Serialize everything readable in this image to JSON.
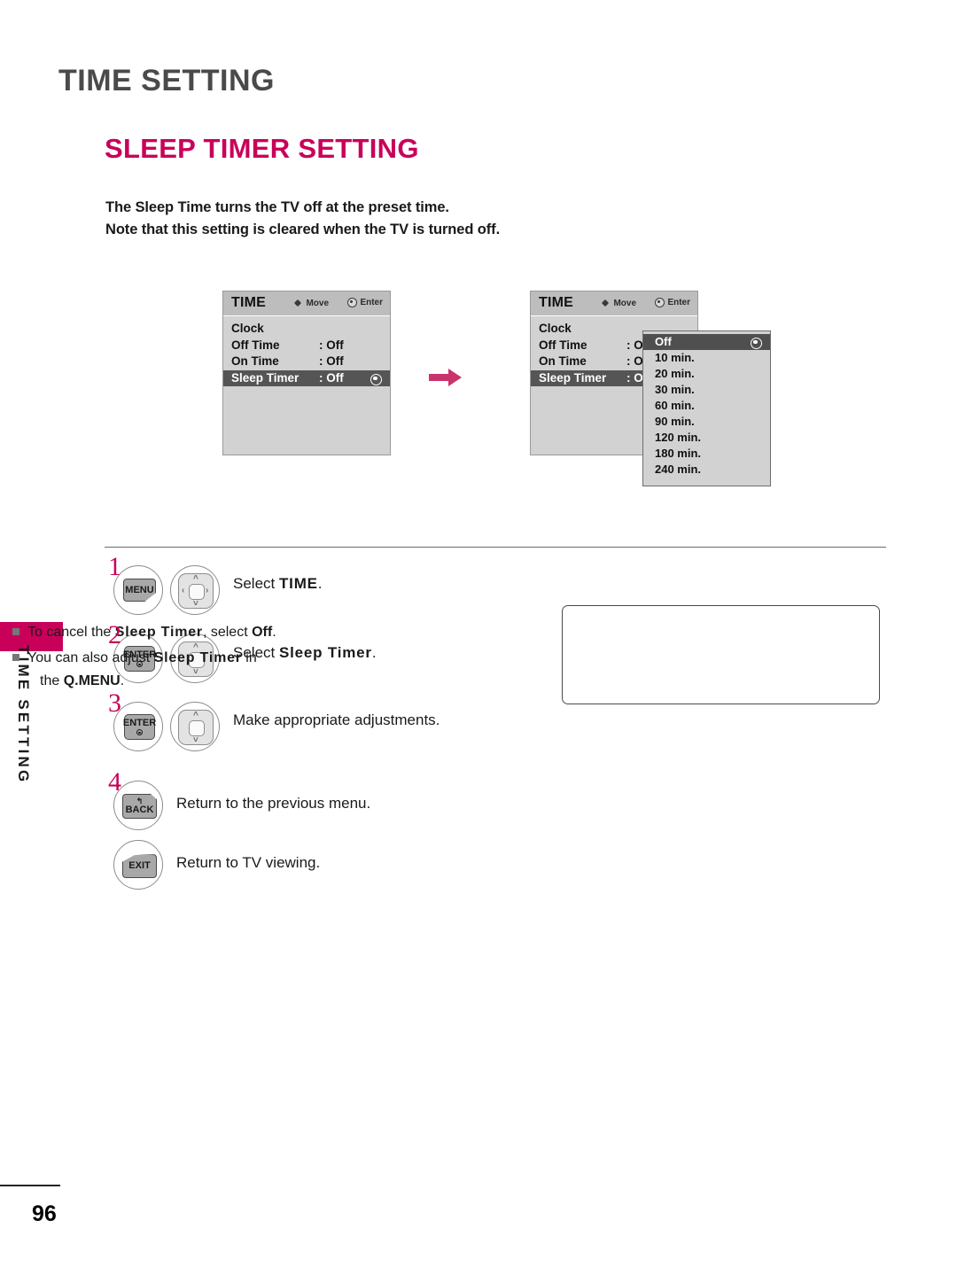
{
  "page": {
    "chapter_title": "TIME SETTING",
    "section_title": "SLEEP TIMER SETTING",
    "intro_line1": "The Sleep Time turns the TV off at the preset time.",
    "intro_line2": "Note that this setting is cleared when the TV is turned off.",
    "side_tab_text": "TIME SETTING",
    "page_number": "96",
    "accent_color": "#c8005a"
  },
  "osd_panel_1": {
    "title": "TIME",
    "hint_move": "Move",
    "hint_enter": "Enter",
    "rows": [
      {
        "label": "Clock",
        "value": "",
        "selected": false
      },
      {
        "label": "Off Time",
        "value": ": Off",
        "selected": false
      },
      {
        "label": "On Time",
        "value": ": Off",
        "selected": false
      },
      {
        "label": "Sleep Timer",
        "value": ": Off",
        "selected": true
      }
    ]
  },
  "osd_panel_2": {
    "title": "TIME",
    "hint_move": "Move",
    "hint_enter": "Enter",
    "rows": [
      {
        "label": "Clock",
        "value": "",
        "selected": false
      },
      {
        "label": "Off Time",
        "value": ": Off",
        "selected": false
      },
      {
        "label": "On Time",
        "value": ": Off",
        "selected": false
      },
      {
        "label": "Sleep Timer",
        "value": ": Off",
        "selected": true
      }
    ],
    "dropdown": {
      "options": [
        {
          "label": "Off",
          "selected": true
        },
        {
          "label": "10 min.",
          "selected": false
        },
        {
          "label": "20 min.",
          "selected": false
        },
        {
          "label": "30 min.",
          "selected": false
        },
        {
          "label": "60 min.",
          "selected": false
        },
        {
          "label": "90 min.",
          "selected": false
        },
        {
          "label": "120 min.",
          "selected": false
        },
        {
          "label": "180 min.",
          "selected": false
        },
        {
          "label": "240 min.",
          "selected": false
        }
      ]
    }
  },
  "steps": [
    {
      "number": "1",
      "key_label": "MENU",
      "text_prefix": "Select ",
      "text_bold": "TIME",
      "text_suffix": "."
    },
    {
      "number": "2",
      "key_label": "ENTER",
      "text_prefix": "Select ",
      "text_bold": "Sleep Timer",
      "text_suffix": "."
    },
    {
      "number": "3",
      "key_label": "ENTER",
      "text_prefix": "Make appropriate adjustments.",
      "text_bold": "",
      "text_suffix": ""
    },
    {
      "number": "4",
      "key_label": "BACK",
      "text_prefix": "Return to the previous menu.",
      "text_bold": "",
      "text_suffix": ""
    },
    {
      "number": "",
      "key_label": "EXIT",
      "text_prefix": "Return to TV viewing.",
      "text_bold": "",
      "text_suffix": ""
    }
  ],
  "notes": {
    "item1_a": "To cancel the ",
    "item1_b": "Sleep Timer",
    "item1_c": ", select ",
    "item1_d": "Off",
    "item1_e": ".",
    "item2_a": "You can also adjust ",
    "item2_b": "Sleep Timer",
    "item2_c": " in",
    "item2_cont_a": "the ",
    "item2_cont_b": "Q.MENU",
    "item2_cont_c": "."
  }
}
